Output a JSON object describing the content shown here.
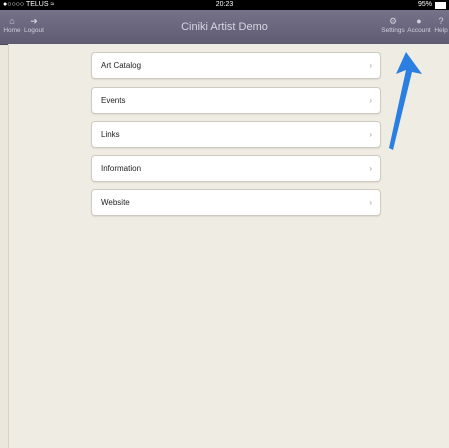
{
  "status": {
    "carrier": "●○○○○ TELUS",
    "wifi": "wifi-icon",
    "time": "20:23",
    "battery": "95%"
  },
  "nav": {
    "title": "Ciniki Artist Demo",
    "left_buttons": [
      {
        "label": "Home",
        "icon": "home-icon"
      },
      {
        "label": "Logout",
        "icon": "logout-icon"
      }
    ],
    "right_buttons": [
      {
        "label": "Settings",
        "icon": "gear-icon"
      },
      {
        "label": "Account",
        "icon": "person-icon"
      },
      {
        "label": "Help",
        "icon": "help-icon"
      }
    ]
  },
  "menu": {
    "items": [
      {
        "label": "Art Catalog"
      },
      {
        "label": "Events"
      },
      {
        "label": "Links"
      },
      {
        "label": "Information"
      },
      {
        "label": "Website"
      }
    ],
    "chevron": "›"
  },
  "annotation": {
    "color": "#2a7fe0"
  }
}
